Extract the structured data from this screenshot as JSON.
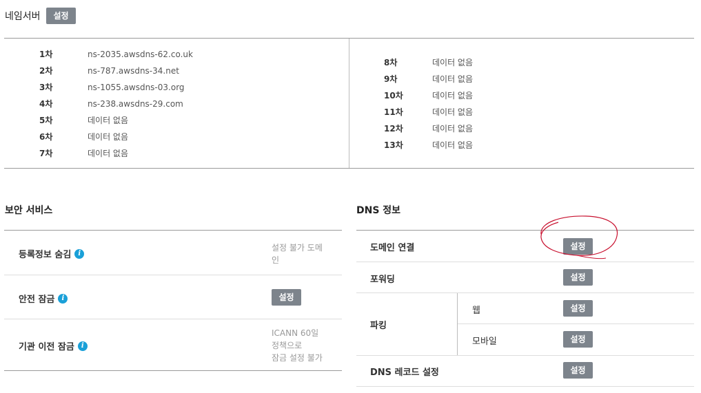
{
  "nameserver": {
    "title": "네임서버",
    "set_label": "설정",
    "left": [
      {
        "label": "1차",
        "value": "ns-2035.awsdns-62.co.uk"
      },
      {
        "label": "2차",
        "value": "ns-787.awsdns-34.net"
      },
      {
        "label": "3차",
        "value": "ns-1055.awsdns-03.org"
      },
      {
        "label": "4차",
        "value": "ns-238.awsdns-29.com"
      },
      {
        "label": "5차",
        "value": "데이터 없음"
      },
      {
        "label": "6차",
        "value": "데이터 없음"
      },
      {
        "label": "7차",
        "value": "데이터 없음"
      }
    ],
    "right": [
      {
        "label": "8차",
        "value": "데이터 없음"
      },
      {
        "label": "9차",
        "value": "데이터 없음"
      },
      {
        "label": "10차",
        "value": "데이터 없음"
      },
      {
        "label": "11차",
        "value": "데이터 없음"
      },
      {
        "label": "12차",
        "value": "데이터 없음"
      },
      {
        "label": "13차",
        "value": "데이터 없음"
      }
    ]
  },
  "security": {
    "title": "보안 서비스",
    "rows": [
      {
        "label": "등록정보 숨김",
        "status_lines": [
          "설정 불가 도메",
          "인"
        ]
      },
      {
        "label": "안전 잠금",
        "button": "설정"
      },
      {
        "label": "기관 이전 잠금",
        "status_lines": [
          "ICANN 60일",
          "정책으로",
          "잠금 설정 불가"
        ]
      }
    ]
  },
  "dns": {
    "title": "DNS 정보",
    "domain_link": {
      "label": "도메인 연결",
      "button": "설정"
    },
    "forwarding": {
      "label": "포워딩",
      "button": "설정"
    },
    "parking": {
      "label": "파킹",
      "web": "웹",
      "web_button": "설정",
      "mobile": "모바일",
      "mobile_button": "설정"
    },
    "dns_record": {
      "label": "DNS 레코드 설정",
      "button": "설정"
    }
  },
  "colors": {
    "button_bg": "#7d848c",
    "info_icon": "#1aa0d8",
    "annotation": "#c8102e"
  },
  "icons": {
    "info": "info-icon"
  }
}
